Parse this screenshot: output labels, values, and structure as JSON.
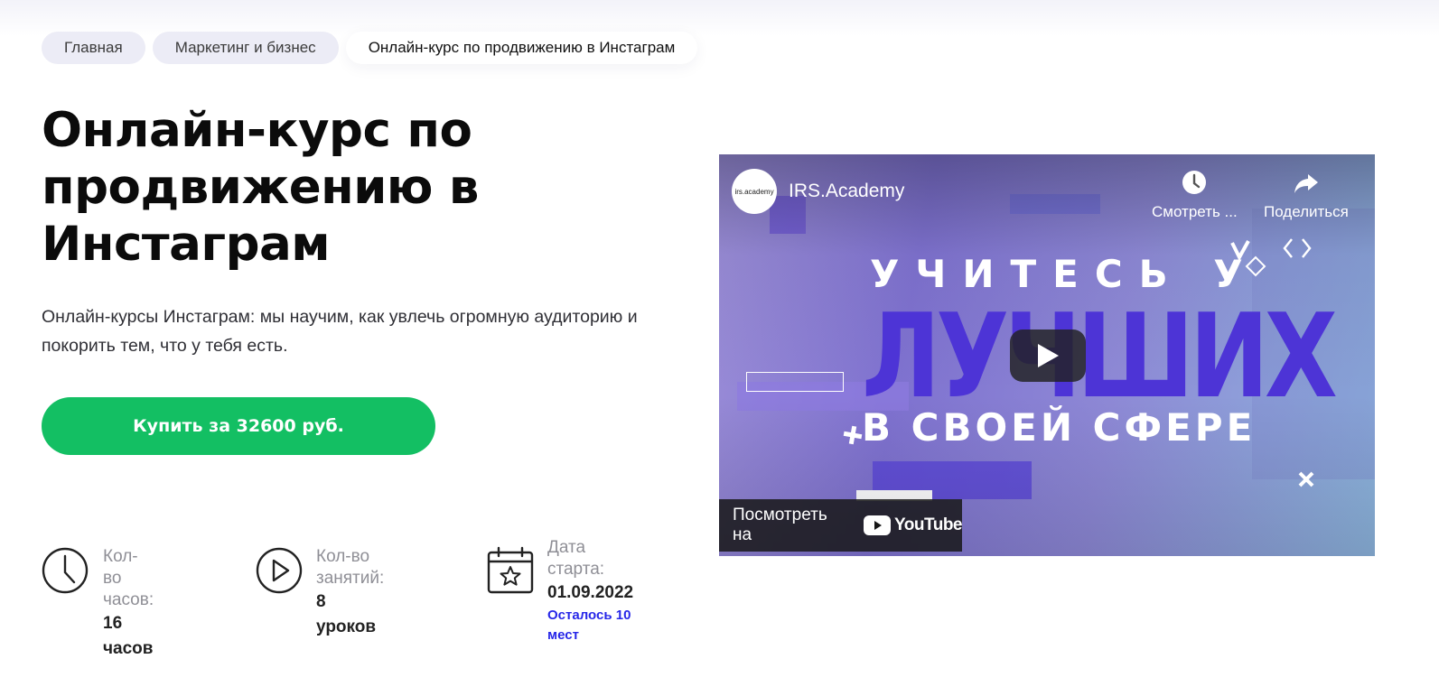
{
  "breadcrumbs": [
    {
      "label": "Главная"
    },
    {
      "label": "Маркетинг и бизнес"
    },
    {
      "label": "Онлайн-курс по продвижению в Инстаграм"
    }
  ],
  "page": {
    "title": "Онлайн-курс по продвижению в Инстаграм",
    "subtitle": "Онлайн-курсы Инстаграм: мы научим, как увлечь огромную аудиторию и покорить тем, что у тебя есть.",
    "buy_button": "Купить за 32600 руб."
  },
  "stats": {
    "hours": {
      "label": "Кол-во часов:",
      "value": "16 часов",
      "icon": "clock-icon"
    },
    "lessons": {
      "label": "Кол-во занятий:",
      "value": "8 уроков",
      "icon": "play-circle-icon"
    },
    "start": {
      "label": "Дата старта:",
      "value": "01.09.2022",
      "note": "Осталось 10 мест",
      "icon": "calendar-star-icon"
    }
  },
  "video": {
    "channel_avatar_text": "irs.academy",
    "channel_name": "IRS.Academy",
    "watch_later_label": "Смотреть ...",
    "share_label": "Поделиться",
    "overlay_line1": "УЧИТЕСЬ У",
    "overlay_line2": "ЛУЧШИХ",
    "overlay_line3": "В СВОЕЙ СФЕРЕ",
    "watch_on_label": "Посмотреть на",
    "youtube_label": "YouTube"
  },
  "colors": {
    "accent_green": "#13bf63",
    "note_blue": "#2727e8",
    "breadcrumb_bg": "#ececf6"
  }
}
